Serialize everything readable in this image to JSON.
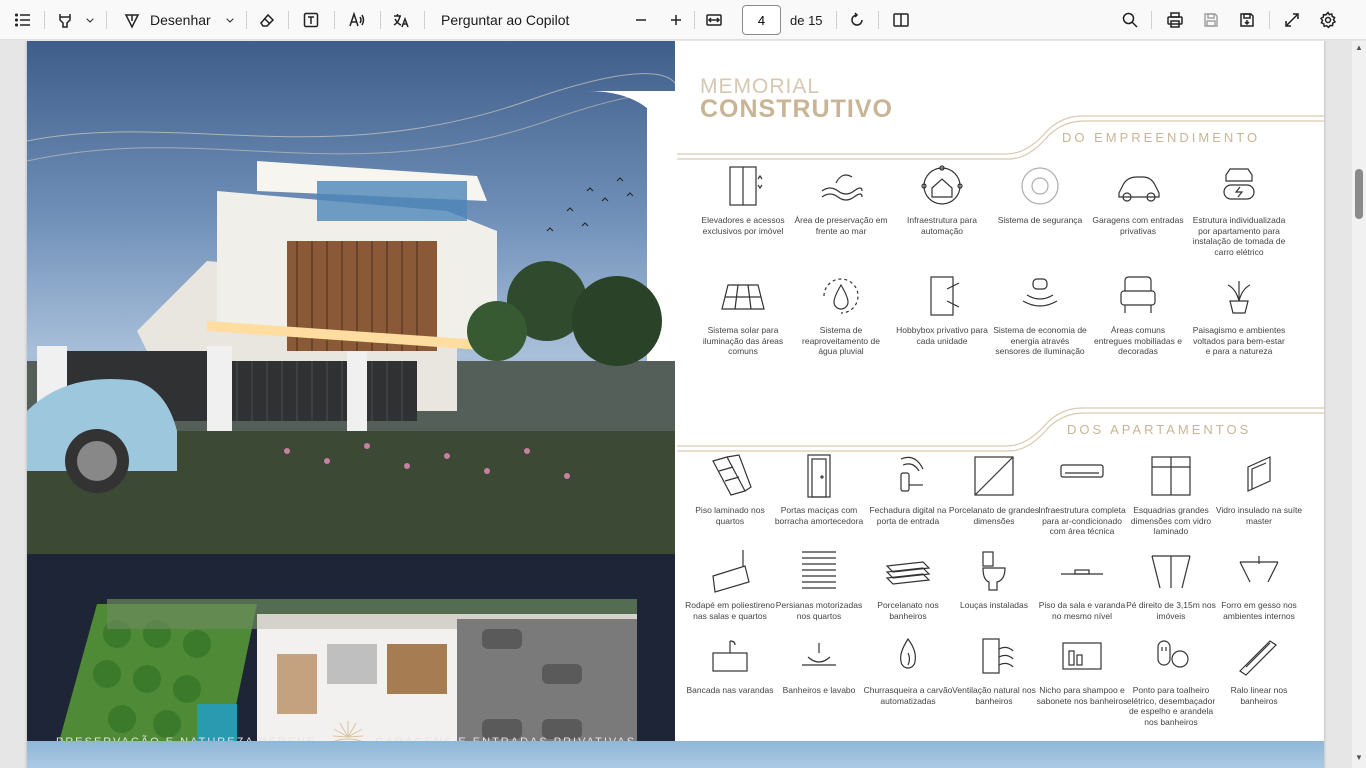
{
  "toolbar": {
    "draw_label": "Desenhar",
    "copilot_label": "Perguntar ao Copilot",
    "page_number": "4",
    "page_total": "de 15"
  },
  "page": {
    "title_line1": "MEMORIAL",
    "title_line2": "CONSTRUTIVO",
    "section_building": "DO EMPREENDIMENTO",
    "section_apartments": "DOS APARTAMENTOS",
    "tagline_left": "PRESERVAÇÃO E NATUREZA PERENE",
    "tagline_right": "GARAGENS E ENTRADAS PRIVATIVAS",
    "building_features": [
      {
        "icon": "elevator-icon",
        "label": "Elevadores e acessos exclusivos por imóvel"
      },
      {
        "icon": "sea-icon",
        "label": "Área de preservação em frente ao mar"
      },
      {
        "icon": "automation-icon",
        "label": "Infraestrutura para automação"
      },
      {
        "icon": "security-icon",
        "label": "Sistema de segurança"
      },
      {
        "icon": "car-icon",
        "label": "Garagens com entradas privativas"
      },
      {
        "icon": "ev-charger-icon",
        "label": "Estrutura individualizada por apartamento para instalação de tomada de carro elétrico"
      },
      {
        "icon": "solar-panel-icon",
        "label": "Sistema solar para iluminação das áreas comuns"
      },
      {
        "icon": "rainwater-icon",
        "label": "Sistema de reaproveitamento de água pluvial"
      },
      {
        "icon": "hobbybox-icon",
        "label": "Hobbybox privativo para cada unidade"
      },
      {
        "icon": "sensor-icon",
        "label": "Sistema de economia de energia através sensores de iluminação"
      },
      {
        "icon": "armchair-icon",
        "label": "Áreas comuns entregues mobiliadas e decoradas"
      },
      {
        "icon": "plant-icon",
        "label": "Paisagismo e ambientes voltados para bem-estar e para a natureza"
      }
    ],
    "apartment_features": [
      {
        "icon": "laminate-floor-icon",
        "label": "Piso laminado nos quartos"
      },
      {
        "icon": "door-icon",
        "label": "Portas maciças com borracha amortecedora"
      },
      {
        "icon": "digital-lock-icon",
        "label": "Fechadura digital na porta de entrada"
      },
      {
        "icon": "tile-icon",
        "label": "Porcelanato de grandes dimensões"
      },
      {
        "icon": "air-conditioner-icon",
        "label": "Infraestrutura completa para ar-condicionado com área técnica"
      },
      {
        "icon": "window-icon",
        "label": "Esquadrias grandes dimensões com vidro laminado"
      },
      {
        "icon": "glass-icon",
        "label": "Vidro insulado na suíte master"
      },
      {
        "icon": "baseboard-icon",
        "label": "Rodapé em poliestireno nas salas e quartos"
      },
      {
        "icon": "blinds-icon",
        "label": "Persianas motorizadas nos quartos"
      },
      {
        "icon": "bathroom-tile-icon",
        "label": "Porcelanato nos banheiros"
      },
      {
        "icon": "toilet-icon",
        "label": "Louças instaladas"
      },
      {
        "icon": "level-floor-icon",
        "label": "Piso da sala e varanda no mesmo nível"
      },
      {
        "icon": "ceiling-height-icon",
        "label": "Pé direito de 3,15m nos imóveis"
      },
      {
        "icon": "ceiling-icon",
        "label": "Forro em gesso nos ambientes internos"
      },
      {
        "icon": "counter-icon",
        "label": "Bancada nas varandas"
      },
      {
        "icon": "sink-icon",
        "label": "Banheiros e lavabo"
      },
      {
        "icon": "barbecue-icon",
        "label": "Churrasqueira a carvão automatizadas"
      },
      {
        "icon": "ventilation-icon",
        "label": "Ventilação natural nos banheiros"
      },
      {
        "icon": "niche-icon",
        "label": "Nicho para shampoo e sabonete nos banheiros"
      },
      {
        "icon": "outlet-icon",
        "label": "Ponto para toalheiro elétrico, desembaçador de espelho e arandela nos banheiros"
      },
      {
        "icon": "drain-icon",
        "label": "Ralo linear nos banheiros"
      }
    ]
  }
}
